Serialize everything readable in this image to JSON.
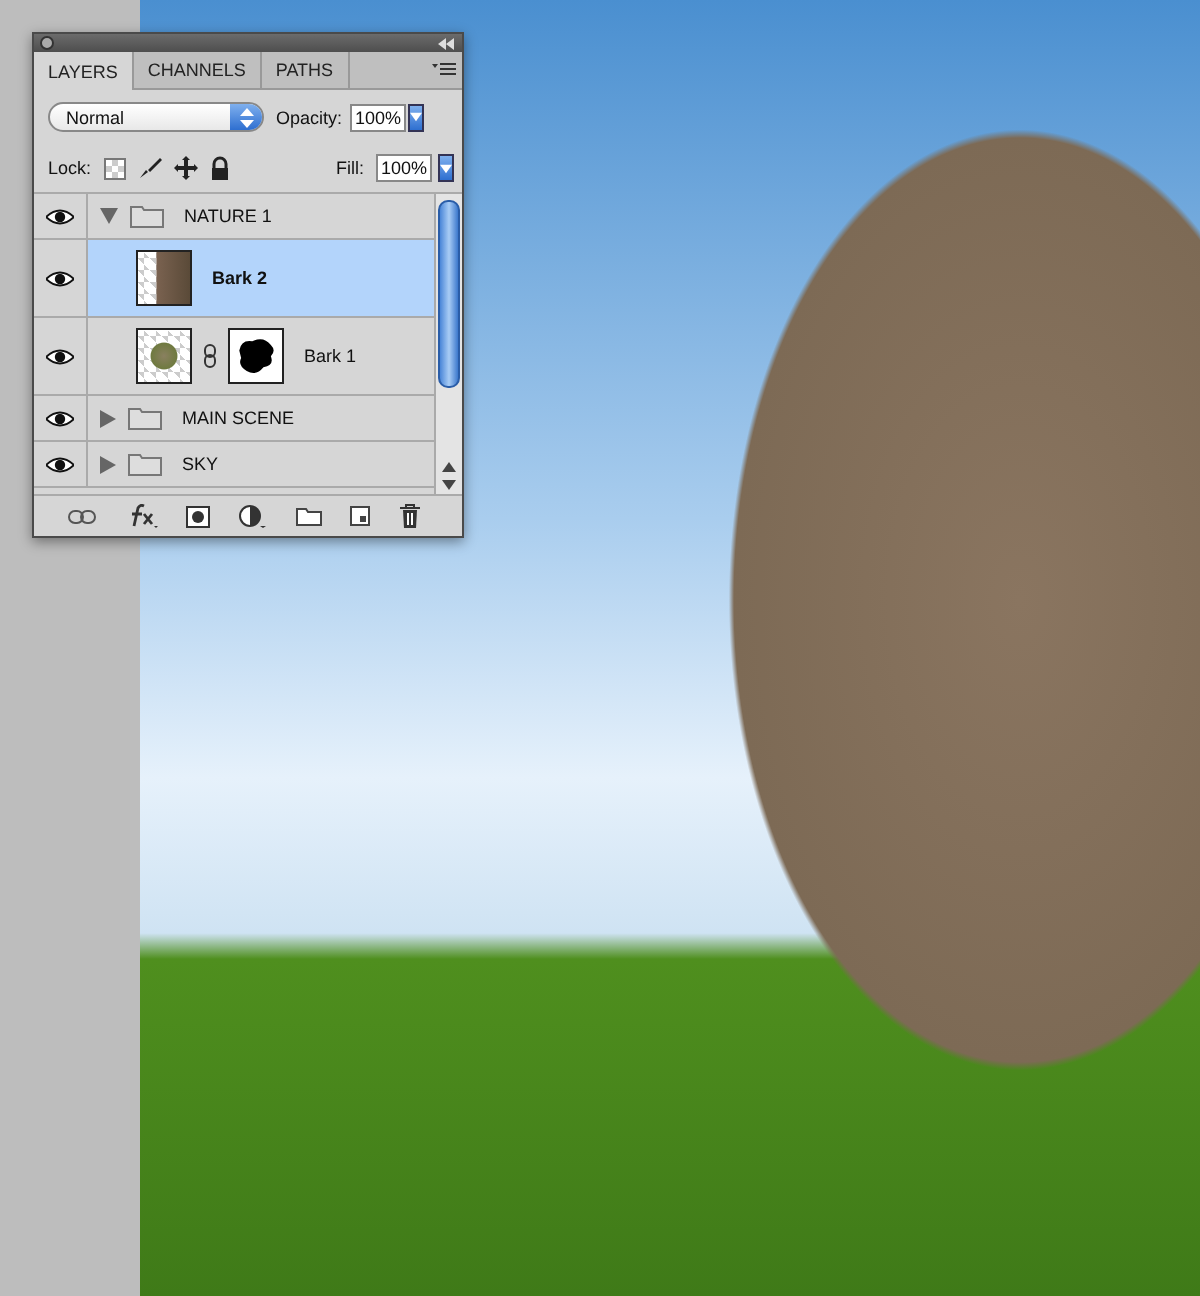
{
  "tabs": [
    {
      "label": "LAYERS",
      "selected": true
    },
    {
      "label": "CHANNELS",
      "selected": false
    },
    {
      "label": "PATHS",
      "selected": false
    }
  ],
  "blend_mode": {
    "value": "Normal"
  },
  "opacity": {
    "label": "Opacity:",
    "value": "100%"
  },
  "lock": {
    "label": "Lock:"
  },
  "fill": {
    "label": "Fill:",
    "value": "100%"
  },
  "layers": [
    {
      "name": "NATURE 1",
      "kind": "group",
      "visible": true,
      "expanded": true,
      "selected": false,
      "children": [
        {
          "name": "Bark 2",
          "kind": "layer",
          "visible": true,
          "selected": true
        },
        {
          "name": "Bark 1",
          "kind": "masked",
          "visible": true,
          "selected": false
        }
      ]
    },
    {
      "name": "MAIN SCENE",
      "kind": "group",
      "visible": true,
      "expanded": false,
      "selected": false
    },
    {
      "name": "SKY",
      "kind": "group",
      "visible": true,
      "expanded": false,
      "selected": false
    }
  ]
}
